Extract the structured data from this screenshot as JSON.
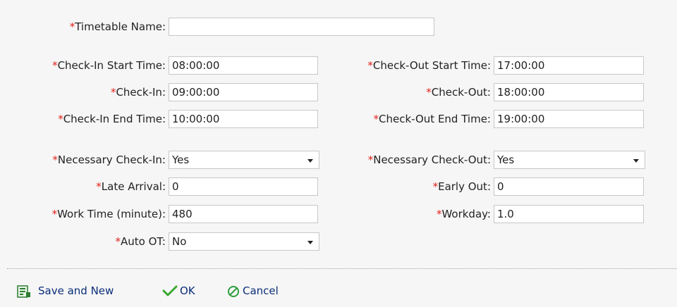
{
  "required_marker": "*",
  "colors": {
    "required": "#e2211c",
    "link": "#0b2e79",
    "ok_icon": "#3aa832",
    "cancel_icon": "#2e9e3f",
    "save_icon": "#2e7d32"
  },
  "form": {
    "timetable_name": {
      "label": "Timetable Name:",
      "value": ""
    },
    "check_in_start": {
      "label": "Check-In Start Time:",
      "value": "08:00:00"
    },
    "check_in": {
      "label": "Check-In:",
      "value": "09:00:00"
    },
    "check_in_end": {
      "label": "Check-In End Time:",
      "value": "10:00:00"
    },
    "check_out_start": {
      "label": "Check-Out Start Time:",
      "value": "17:00:00"
    },
    "check_out": {
      "label": "Check-Out:",
      "value": "18:00:00"
    },
    "check_out_end": {
      "label": "Check-Out End Time:",
      "value": "19:00:00"
    },
    "necessary_check_in": {
      "label": "Necessary Check-In:",
      "value": "Yes"
    },
    "late_arrival": {
      "label": "Late Arrival:",
      "value": "0"
    },
    "work_time": {
      "label": "Work Time (minute):",
      "value": "480"
    },
    "auto_ot": {
      "label": "Auto OT:",
      "value": "No"
    },
    "necessary_check_out": {
      "label": "Necessary Check-Out:",
      "value": "Yes"
    },
    "early_out": {
      "label": "Early Out:",
      "value": "0"
    },
    "workday": {
      "label": "Workday:",
      "value": "1.0"
    }
  },
  "actions": {
    "save_and_new": {
      "label": "Save and New",
      "icon": "save-new-icon"
    },
    "ok": {
      "label": "OK",
      "icon": "check-icon"
    },
    "cancel": {
      "label": "Cancel",
      "icon": "cancel-icon"
    }
  }
}
